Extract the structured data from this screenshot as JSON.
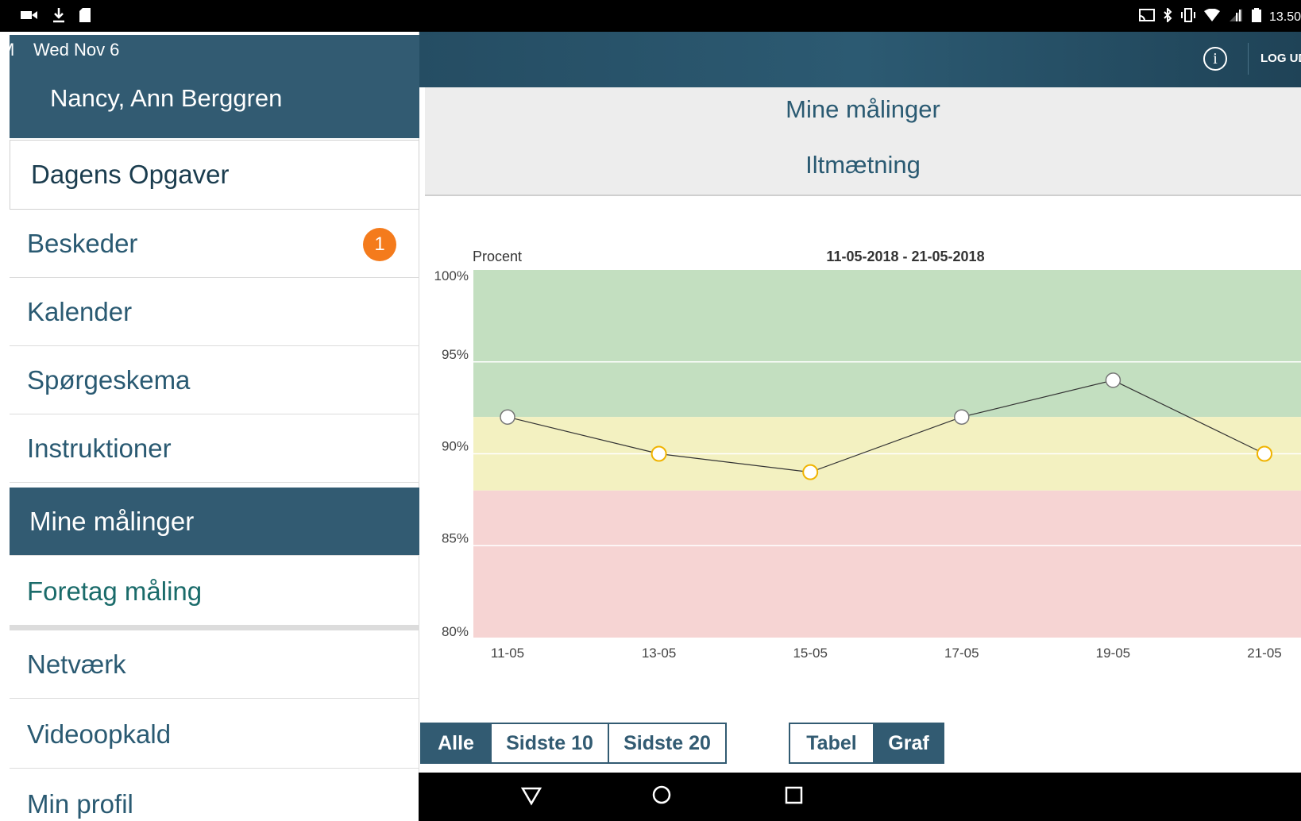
{
  "statusbar": {
    "time": "13.50",
    "left_icons": [
      "video-icon",
      "download-icon",
      "sd-card-icon"
    ],
    "right_icons": [
      "cast-icon",
      "bluetooth-icon",
      "vibrate-icon",
      "wifi-icon",
      "signal-icon",
      "battery-icon"
    ]
  },
  "header": {
    "info_label": "i",
    "logout_label": "LOG UD"
  },
  "sidebar": {
    "date_prefix": "M",
    "date": "Wed Nov 6",
    "user_name": "Nancy, Ann Berggren",
    "items": [
      {
        "label": "Dagens Opgaver"
      },
      {
        "label": "Beskeder",
        "badge": "1"
      },
      {
        "label": "Kalender"
      },
      {
        "label": "Spørgeskema"
      },
      {
        "label": "Instruktioner"
      },
      {
        "label": "Mine målinger"
      },
      {
        "label": "Foretag måling"
      },
      {
        "label": "Netværk"
      },
      {
        "label": "Videoopkald"
      },
      {
        "label": "Min profil"
      }
    ]
  },
  "main": {
    "title": "Mine målinger",
    "subtitle": "Iltmætning"
  },
  "chart_data": {
    "type": "line",
    "title": "11-05-2018 - 21-05-2018",
    "ylabel": "Procent",
    "xlabel": "",
    "ylim": [
      80,
      100
    ],
    "yticks": [
      "100%",
      "95%",
      "90%",
      "85%",
      "80%"
    ],
    "ytick_values": [
      100,
      95,
      90,
      85,
      80
    ],
    "categories": [
      "11-05",
      "13-05",
      "15-05",
      "17-05",
      "19-05",
      "21-05"
    ],
    "values": [
      92,
      90,
      89,
      92,
      94,
      90
    ],
    "point_status": [
      "normal",
      "warning",
      "warning",
      "normal",
      "normal",
      "warning"
    ],
    "zones": [
      {
        "from": 92,
        "to": 100,
        "color": "#c3dfc0"
      },
      {
        "from": 88,
        "to": 92,
        "color": "#f3f1c1"
      },
      {
        "from": 80,
        "to": 88,
        "color": "#f6d4d3"
      }
    ],
    "colors": {
      "normal_marker": "#ffffff",
      "warning_marker": "#f0b300",
      "line": "#333333"
    },
    "grid": true
  },
  "controls": {
    "range_options": [
      "Alle",
      "Sidste 10",
      "Sidste 20"
    ],
    "range_selected": "Alle",
    "view_options": [
      "Tabel",
      "Graf"
    ],
    "view_selected": "Graf"
  },
  "navbar": {
    "buttons": [
      "back-icon",
      "home-icon",
      "recents-icon"
    ]
  }
}
